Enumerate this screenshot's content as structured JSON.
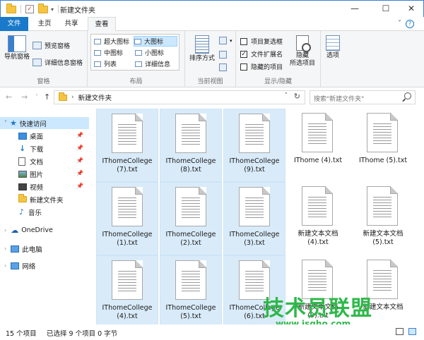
{
  "window": {
    "title": "新建文件夹",
    "minimize": "—",
    "maximize": "☐",
    "close": "✕"
  },
  "tabs": [
    "文件",
    "主页",
    "共享",
    "查看"
  ],
  "ribbon": {
    "panes": {
      "nav_pane": "导航窗格",
      "preview_pane": "预览窗格",
      "details_pane": "详细信息窗格",
      "label": "窗格"
    },
    "layout": {
      "items": [
        "超大图标",
        "大图标",
        "中图标",
        "小图标",
        "列表",
        "详细信息"
      ],
      "selected": "大图标",
      "label": "布局"
    },
    "current_view": {
      "sort_by": "排序方式",
      "label": "当前视图"
    },
    "show_hide": {
      "item_checkboxes": "项目复选框",
      "file_extensions": "文件扩展名",
      "hidden_items": "隐藏的项目",
      "hide_selected_line1": "隐藏",
      "hide_selected_line2": "所选项目",
      "label": "显示/隐藏"
    },
    "options": {
      "label": "选项"
    }
  },
  "address": {
    "path": "新建文件夹",
    "search_placeholder": "搜索\"新建文件夹\""
  },
  "sidebar": {
    "items": [
      {
        "label": "快速访问",
        "icon": "star-icon",
        "pinned": false
      },
      {
        "label": "桌面",
        "icon": "desktop-icon",
        "pinned": true
      },
      {
        "label": "下载",
        "icon": "download-icon",
        "pinned": true
      },
      {
        "label": "文档",
        "icon": "documents-icon",
        "pinned": true
      },
      {
        "label": "图片",
        "icon": "pictures-icon",
        "pinned": true
      },
      {
        "label": "视频",
        "icon": "videos-icon",
        "pinned": true
      },
      {
        "label": "新建文件夹",
        "icon": "folder-icon",
        "pinned": false
      },
      {
        "label": "音乐",
        "icon": "music-icon",
        "pinned": false
      },
      {
        "label": "OneDrive",
        "icon": "cloud-icon",
        "pinned": false
      },
      {
        "label": "此电脑",
        "icon": "computer-icon",
        "pinned": false
      },
      {
        "label": "网络",
        "icon": "network-icon",
        "pinned": false
      }
    ]
  },
  "files": [
    {
      "line1": "IThomeCollege",
      "line2": "(7).txt",
      "selected": true
    },
    {
      "line1": "IThomeCollege",
      "line2": "(8).txt",
      "selected": true
    },
    {
      "line1": "IThomeCollege",
      "line2": "(9).txt",
      "selected": true
    },
    {
      "line1": "IThome (4).txt",
      "line2": "",
      "selected": false
    },
    {
      "line1": "IThome (5).txt",
      "line2": "",
      "selected": false
    },
    {
      "line1": "IThomeCollege",
      "line2": "(1).txt",
      "selected": true
    },
    {
      "line1": "IThomeCollege",
      "line2": "(2).txt",
      "selected": true
    },
    {
      "line1": "IThomeCollege",
      "line2": "(3).txt",
      "selected": true
    },
    {
      "line1": "新建文本文档",
      "line2": "(4).txt",
      "selected": false
    },
    {
      "line1": "新建文本文档",
      "line2": "(5).txt",
      "selected": false
    },
    {
      "line1": "IThomeCollege",
      "line2": "(4).txt",
      "selected": true
    },
    {
      "line1": "IThomeCollege",
      "line2": "(5).txt",
      "selected": true
    },
    {
      "line1": "IThomeCollege",
      "line2": "(6).txt",
      "selected": true
    },
    {
      "line1": "新建文本文档",
      "line2": "(9).txt",
      "selected": false
    },
    {
      "line1": "新建文本文档",
      "line2": "",
      "selected": false
    }
  ],
  "status": {
    "count": "15 个项目",
    "selection": "已选择 9 个项目  0 字节"
  },
  "watermark": {
    "text": "技术员联盟",
    "url": "www.jsgho.com"
  }
}
